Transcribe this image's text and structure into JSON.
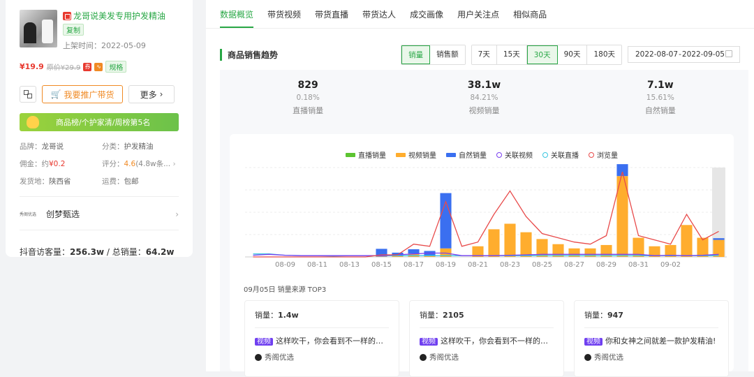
{
  "product": {
    "title": "龙哥说美发专用护发精油",
    "copy_label": "复制",
    "listed_date": "上架时间：2022-05-09",
    "price": "¥19.9",
    "original_price": "原价¥29.9",
    "coupon_icon": "券",
    "spec_label": "规格",
    "promo_button": "我要推广带货",
    "more_button": "更多",
    "rank_text": "商品榜/个护家清/周榜第5名",
    "attrs": [
      {
        "k": "品牌：",
        "v": "龙哥说"
      },
      {
        "k": "分类：",
        "v": "护发精油"
      },
      {
        "k": "佣金：约",
        "v": "¥0.2"
      },
      {
        "k": "评分：",
        "v": "4.6",
        "extra": "(4.8w条..."
      },
      {
        "k": "发货地：",
        "v": "陕西省"
      },
      {
        "k": "运费：",
        "v": "包邮"
      }
    ],
    "shop_logo_text": "秀阁优选",
    "shop_name": "创梦甄选",
    "visits_label": "抖音访客量：",
    "visits_value": "256.3w",
    "sales_label": " / 总销量：",
    "sales_value": "64.2w"
  },
  "tabs": [
    "数据概览",
    "带货视频",
    "带货直播",
    "带货达人",
    "成交画像",
    "用户关注点",
    "相似商品"
  ],
  "section": {
    "title": "商品销售趋势",
    "metric_options": [
      "销量",
      "销售额"
    ],
    "metric_selected": "销量",
    "range_options": [
      "7天",
      "15天",
      "30天",
      "90天",
      "180天"
    ],
    "range_selected": "30天",
    "date_start": "2022-08-07",
    "date_sep": "-",
    "date_end": "2022-09-05"
  },
  "stats": [
    {
      "value": "829",
      "pct": "0.18%",
      "label": "直播销量"
    },
    {
      "value": "38.1w",
      "pct": "84.21%",
      "label": "视频销量"
    },
    {
      "value": "7.1w",
      "pct": "15.61%",
      "label": "自然销量"
    }
  ],
  "colors": {
    "live": "#5cc431",
    "video": "#ffad2e",
    "natural": "#3a6ff0",
    "rel_video": "#7a3ff0",
    "rel_live": "#3ac6e0",
    "views": "#e84a4a",
    "accent": "#28a745"
  },
  "chart_data": {
    "type": "bar",
    "x": [
      "08-07",
      "08-08",
      "08-09",
      "08-10",
      "08-11",
      "08-12",
      "08-13",
      "08-14",
      "08-15",
      "08-16",
      "08-17",
      "08-18",
      "08-19",
      "08-20",
      "08-21",
      "08-22",
      "08-23",
      "08-24",
      "08-25",
      "08-26",
      "08-27",
      "08-28",
      "08-29",
      "08-30",
      "08-31",
      "09-01",
      "09-02",
      "09-03",
      "09-04",
      "09-05"
    ],
    "tick_labels": [
      "08-09",
      "08-11",
      "08-13",
      "08-15",
      "08-17",
      "08-19",
      "08-21",
      "08-23",
      "08-25",
      "08-27",
      "08-29",
      "08-31",
      "09-02"
    ],
    "legend": [
      "直播销量",
      "视频销量",
      "自然销量",
      "关联视频",
      "关联直播",
      "浏览量"
    ],
    "series": [
      {
        "name": "直播销量",
        "kind": "bar",
        "values": [
          0,
          0,
          0,
          0,
          0,
          0,
          0,
          0,
          0,
          0,
          0,
          0,
          0,
          0,
          0,
          0,
          0,
          0,
          0,
          0,
          0,
          0,
          0,
          0,
          0,
          0,
          0,
          0,
          0,
          0
        ]
      },
      {
        "name": "视频销量",
        "kind": "bar",
        "values": [
          0,
          0,
          0,
          0,
          0,
          0,
          0,
          0,
          1,
          2,
          8,
          2,
          20,
          0,
          25,
          65,
          78,
          58,
          42,
          30,
          20,
          20,
          28,
          190,
          45,
          25,
          28,
          75,
          45,
          40
        ]
      },
      {
        "name": "自然销量",
        "kind": "bar",
        "values": [
          0,
          0,
          0,
          0,
          0,
          0,
          0,
          0,
          18,
          8,
          10,
          12,
          130,
          0,
          0,
          0,
          0,
          0,
          0,
          0,
          0,
          0,
          0,
          28,
          0,
          0,
          0,
          0,
          0,
          4
        ]
      },
      {
        "name": "关联视频",
        "kind": "line",
        "values": [
          4,
          6,
          4,
          3,
          3,
          3,
          3,
          3,
          3,
          5,
          7,
          9,
          9,
          3,
          3,
          3,
          4,
          5,
          6,
          6,
          6,
          6,
          6,
          6,
          6,
          3,
          4,
          3,
          4,
          6
        ]
      },
      {
        "name": "关联直播",
        "kind": "line",
        "values": [
          7,
          7,
          4,
          3,
          3,
          2,
          3,
          3,
          3,
          3,
          3,
          3,
          3,
          3,
          3,
          3,
          3,
          3,
          3,
          3,
          3,
          3,
          3,
          3,
          3,
          3,
          3,
          3,
          3,
          3
        ]
      },
      {
        "name": "浏览量",
        "kind": "line",
        "values": [
          0,
          0,
          0,
          0,
          0,
          0,
          0,
          0,
          5,
          5,
          30,
          25,
          130,
          25,
          35,
          100,
          155,
          95,
          55,
          45,
          35,
          30,
          50,
          200,
          50,
          40,
          30,
          100,
          40,
          60
        ]
      }
    ],
    "top3_title": "09月05日 销量来源 TOP3"
  },
  "top3": [
    {
      "sales_label": "销量：",
      "sales": "1.4w",
      "tag": "视频",
      "desc": "这样吹干，你会看到不一样的头...",
      "source": "秀阁优选"
    },
    {
      "sales_label": "销量：",
      "sales": "2105",
      "tag": "视频",
      "desc": "这样吹干，你会看到不一样的头...",
      "source": "秀阁优选"
    },
    {
      "sales_label": "销量：",
      "sales": "947",
      "tag": "视频",
      "desc": "你和女神之间就差一款护发精油!",
      "source": "秀阁优选"
    }
  ]
}
